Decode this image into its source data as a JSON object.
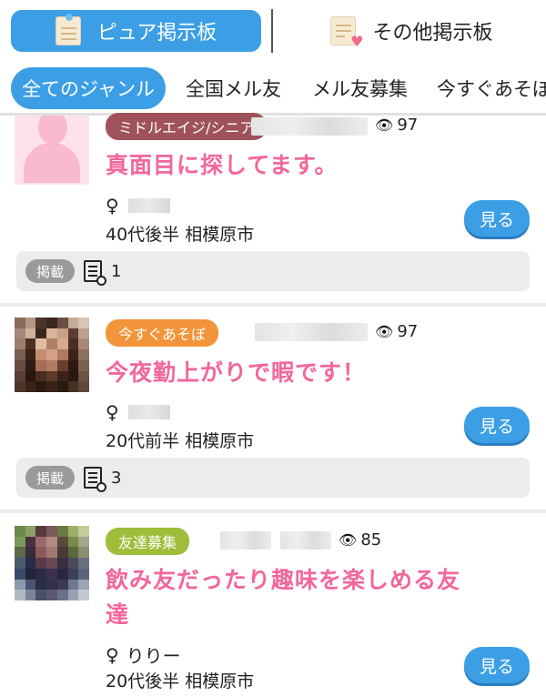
{
  "board_tabs": {
    "pure": "ピュア掲示板",
    "other": "その他掲示板"
  },
  "genre_tabs": [
    {
      "label": "全てのジャンル"
    },
    {
      "label": "全国メル友"
    },
    {
      "label": "メル友募集"
    },
    {
      "label": "今すぐあそぼ"
    }
  ],
  "posts": [
    {
      "badge": "ミドルエイジ/シニア",
      "views": "97",
      "title": "真面目に探してます。",
      "gender_symbol": "♀",
      "age_location": "40代後半 相模原市",
      "view_button": "見る",
      "posted_label": "掲載",
      "posted_count": "1"
    },
    {
      "badge": "今すぐあそぼ",
      "views": "97",
      "title": "今夜勤上がりで暇です！",
      "gender_symbol": "♀",
      "age_location": "20代前半 相模原市",
      "view_button": "見る",
      "posted_label": "掲載",
      "posted_count": "3"
    },
    {
      "badge": "友達募集",
      "views": "85",
      "title_line1": "飲み友だったり趣味を楽しめる友",
      "title_line2": "達",
      "gender_symbol": "♀",
      "nickname": "りりー",
      "age_location": "20代後半 相模原市",
      "view_button": "見る"
    }
  ],
  "colors": {
    "accent_blue": "#3c9fe6",
    "title_pink": "#f2679a",
    "badge_middle": "#a0525a",
    "badge_now": "#f2953a",
    "badge_friend": "#9fbd3a"
  }
}
